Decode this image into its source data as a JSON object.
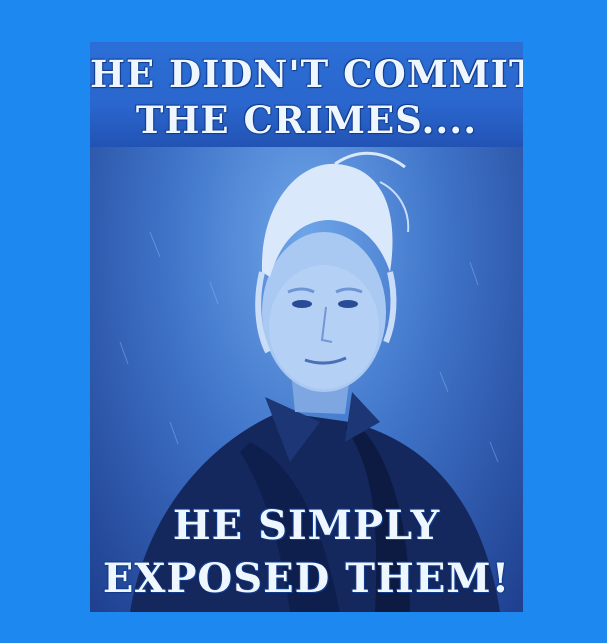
{
  "poster": {
    "headline_top_line1": "HE DIDN'T COMMIT",
    "headline_top_line2": "THE CRIMES....",
    "headline_bottom_line1": "HE SIMPLY",
    "headline_bottom_line2": "EXPOSED THEM!"
  },
  "colors": {
    "background": "#1c88f0",
    "tint": "#3f74c9",
    "text": "#eef6ff"
  }
}
